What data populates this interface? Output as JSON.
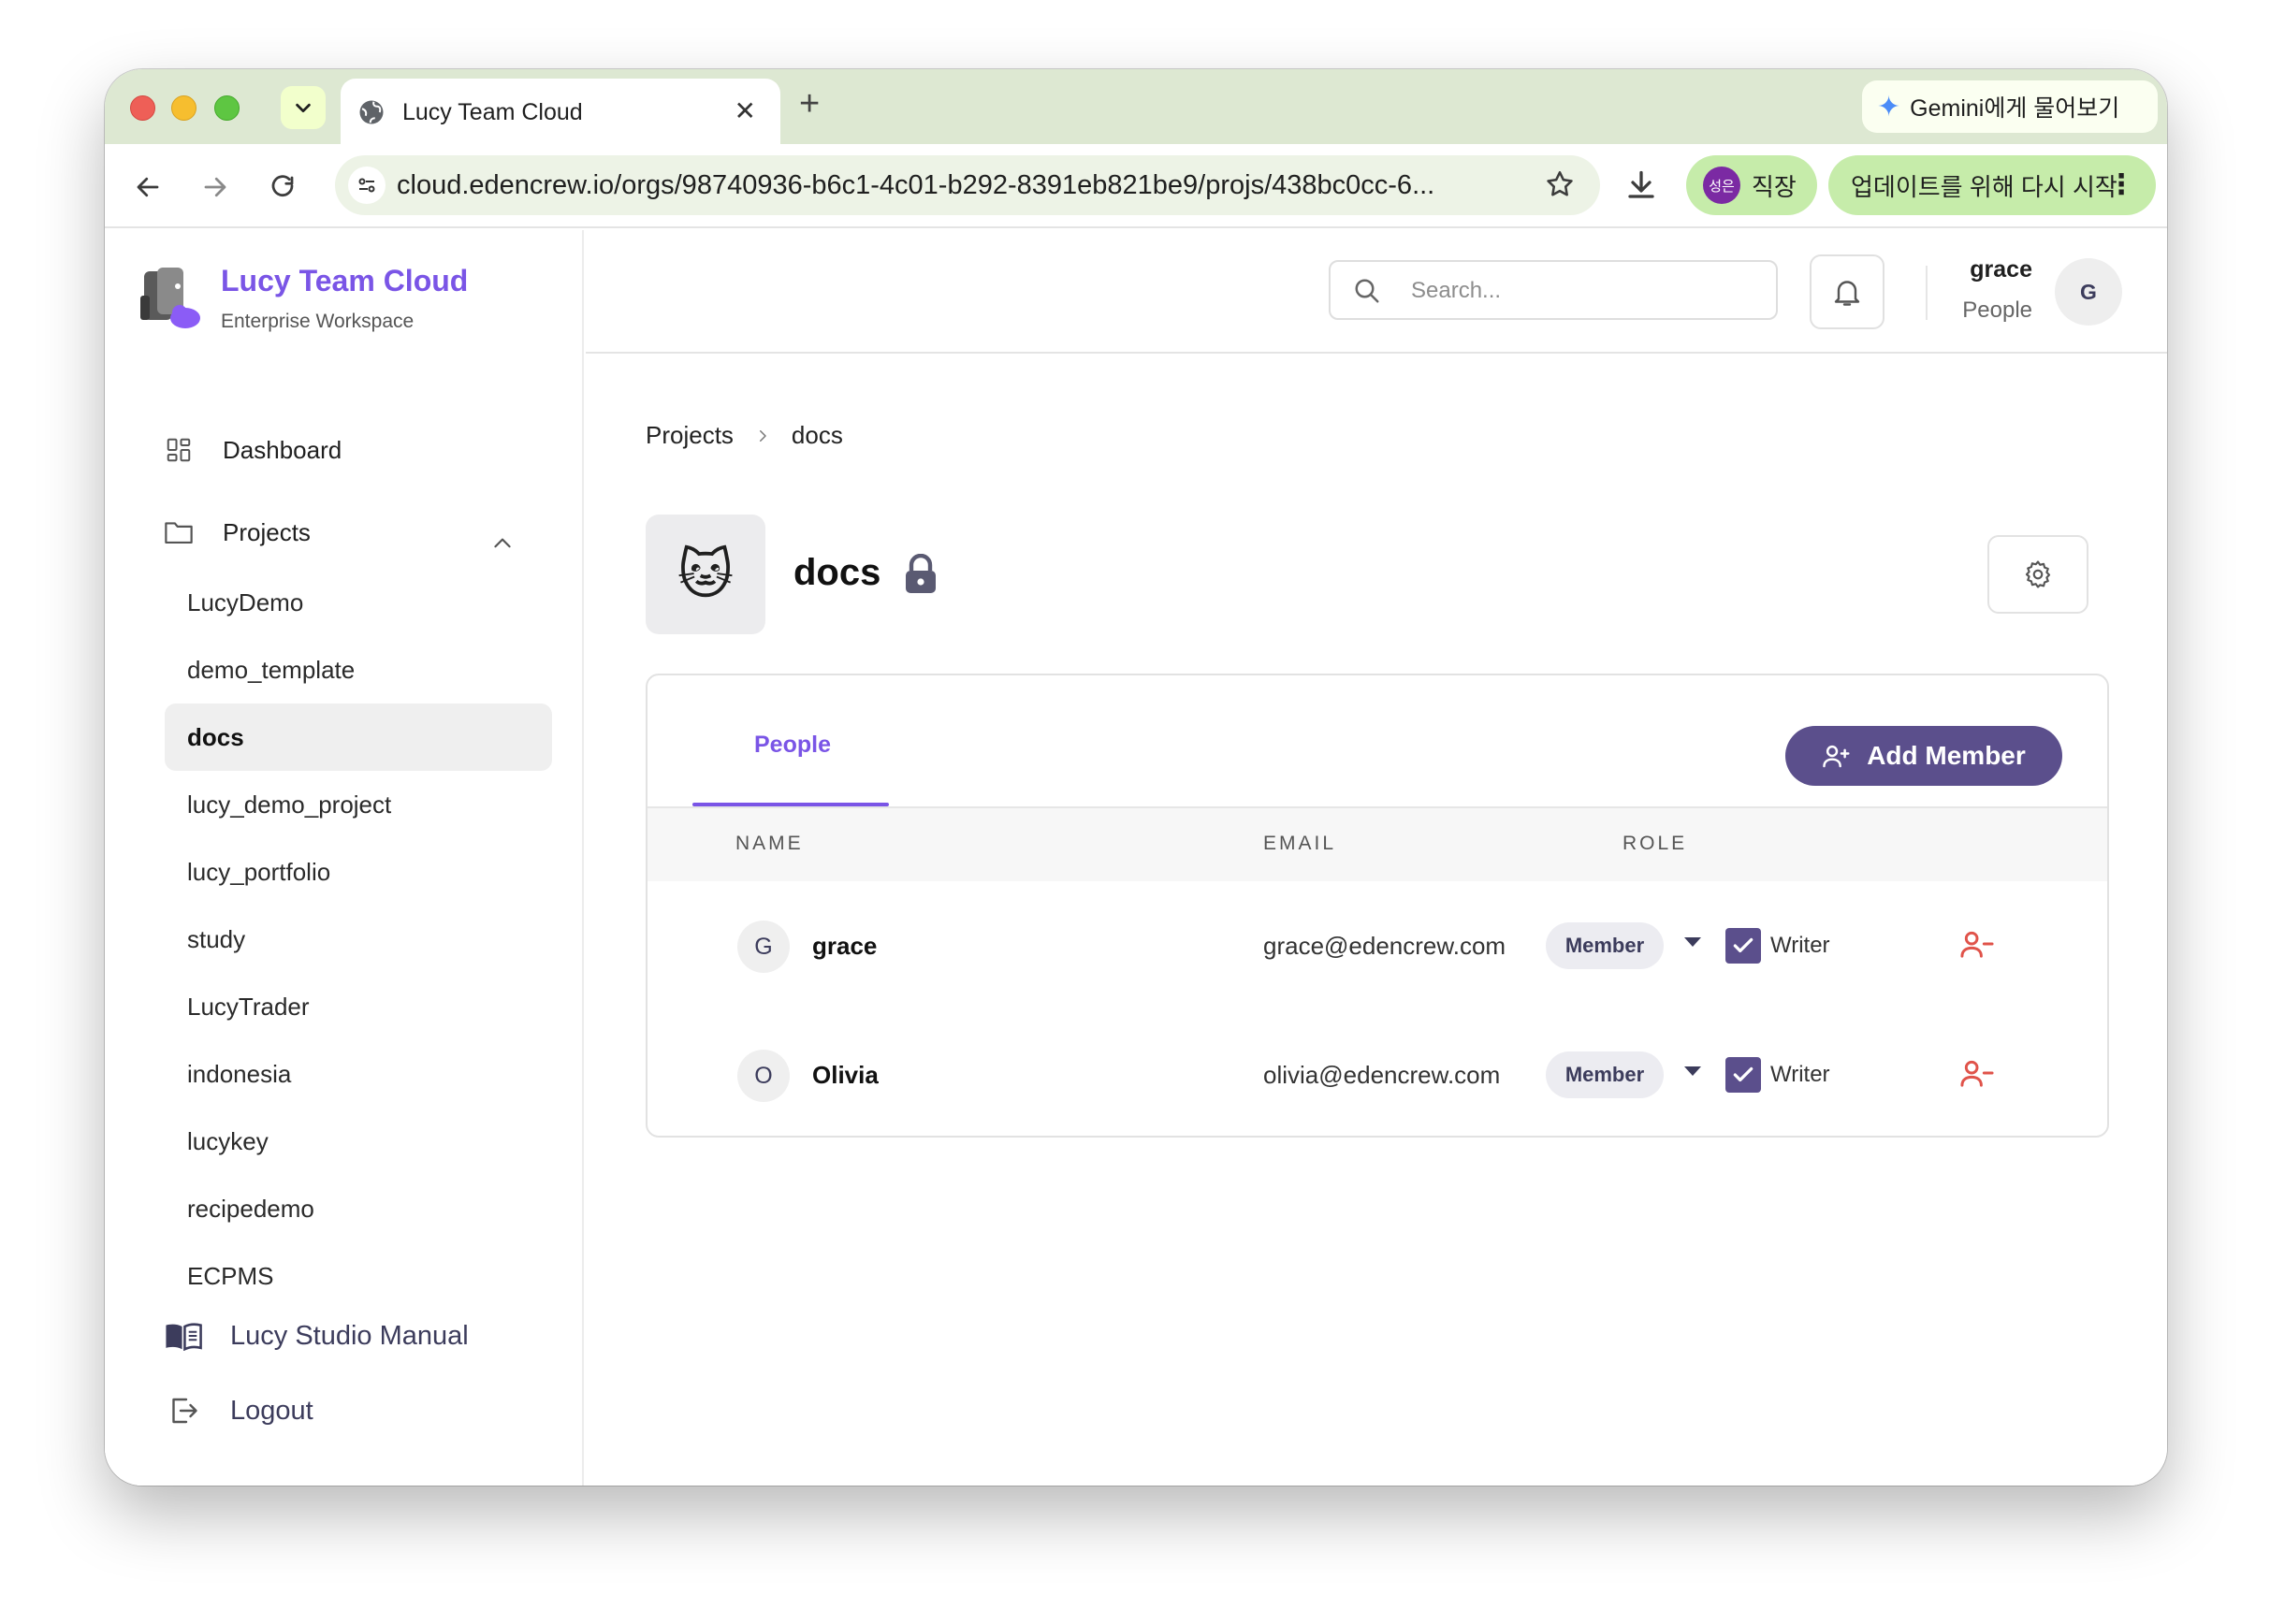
{
  "browser": {
    "tab_title": "Lucy Team Cloud",
    "tab_close": "✕",
    "new_tab": "+",
    "gemini_label": "Gemini에게 물어보기",
    "url": "cloud.edencrew.io/orgs/98740936-b6c1-4c01-b292-8391eb821be9/projs/438bc0cc-6...",
    "profile_initials": "성은",
    "profile_name": "직장",
    "update_label": "업데이트를 위해 다시 시작"
  },
  "brand": {
    "name": "Lucy Team Cloud",
    "subtitle": "Enterprise Workspace"
  },
  "sidebar": {
    "dashboard": "Dashboard",
    "projects": "Projects",
    "project_items": [
      "LucyDemo",
      "demo_template",
      "docs",
      "lucy_demo_project",
      "lucy_portfolio",
      "study",
      "LucyTrader",
      "indonesia",
      "lucykey",
      "recipedemo",
      "ECPMS"
    ],
    "active_project": "docs",
    "manual": "Lucy Studio Manual",
    "logout": "Logout"
  },
  "header": {
    "search_placeholder": "Search...",
    "user_name": "grace",
    "user_role": "People",
    "user_initial": "G"
  },
  "breadcrumb": {
    "root": "Projects",
    "current": "docs"
  },
  "project": {
    "icon": "🐱",
    "title": "docs",
    "private": true
  },
  "members": {
    "tab_label": "People",
    "add_button": "Add Member",
    "columns": {
      "name": "NAME",
      "email": "EMAIL",
      "role": "ROLE"
    },
    "rows": [
      {
        "initial": "G",
        "name": "grace",
        "email": "grace@edencrew.com",
        "role": "Member",
        "permission": "Writer",
        "writer_checked": true
      },
      {
        "initial": "O",
        "name": "Olivia",
        "email": "olivia@edencrew.com",
        "role": "Member",
        "permission": "Writer",
        "writer_checked": true
      }
    ]
  },
  "colors": {
    "accent": "#7a55e6",
    "button": "#5b4f8c",
    "danger": "#e0534a",
    "tabstrip": "#dde8d2",
    "chip": "#c6ecaa"
  }
}
